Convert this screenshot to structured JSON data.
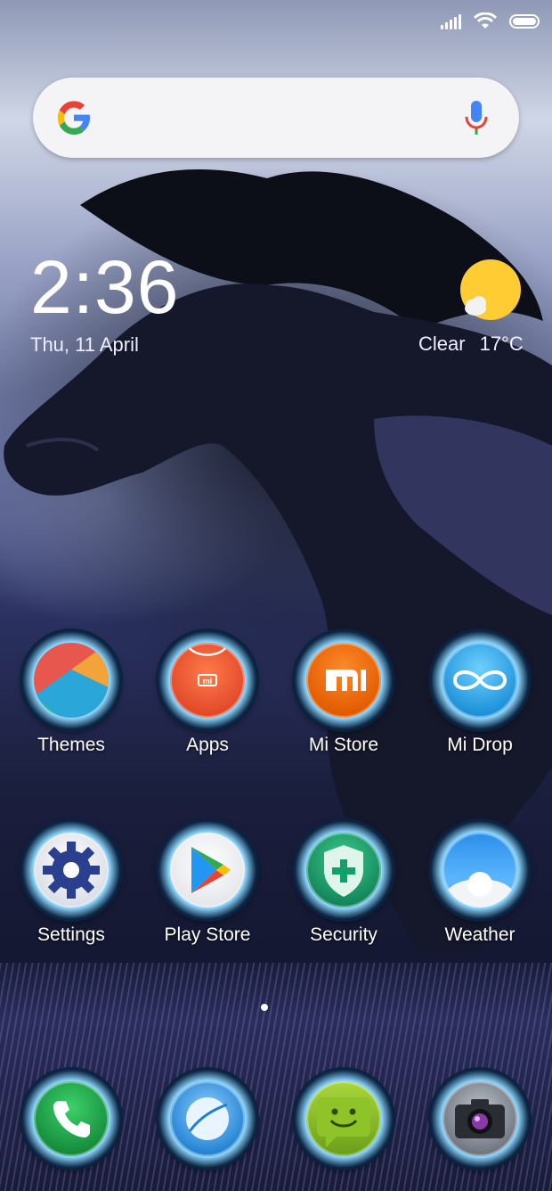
{
  "status_bar": {
    "icons": [
      "signal-icon",
      "wifi-icon",
      "battery-icon"
    ]
  },
  "search": {
    "logo": "google-logo",
    "mic": "mic-icon"
  },
  "clock": {
    "time": "2:36",
    "date": "Thu, 11 April"
  },
  "weather": {
    "condition": "Clear",
    "temp": "17°C",
    "icon": "sun-cloud-icon"
  },
  "apps": [
    {
      "label": "Themes",
      "icon": "themes-icon"
    },
    {
      "label": "Apps",
      "icon": "mi-apps-icon"
    },
    {
      "label": "Mi Store",
      "icon": "mi-store-icon"
    },
    {
      "label": "Mi Drop",
      "icon": "mi-drop-icon"
    },
    {
      "label": "Settings",
      "icon": "gear-icon"
    },
    {
      "label": "Play Store",
      "icon": "play-store-icon"
    },
    {
      "label": "Security",
      "icon": "shield-icon"
    },
    {
      "label": "Weather",
      "icon": "weather-icon"
    }
  ],
  "dock": [
    {
      "icon": "phone-icon"
    },
    {
      "icon": "browser-icon"
    },
    {
      "icon": "messages-icon"
    },
    {
      "icon": "camera-icon"
    }
  ],
  "page_indicator": {
    "pages": 1,
    "current": 1
  },
  "colors": {
    "accent_ring": "#2b7bb8",
    "search_bg": "#f4f4f6",
    "sun": "#ffcc33"
  }
}
